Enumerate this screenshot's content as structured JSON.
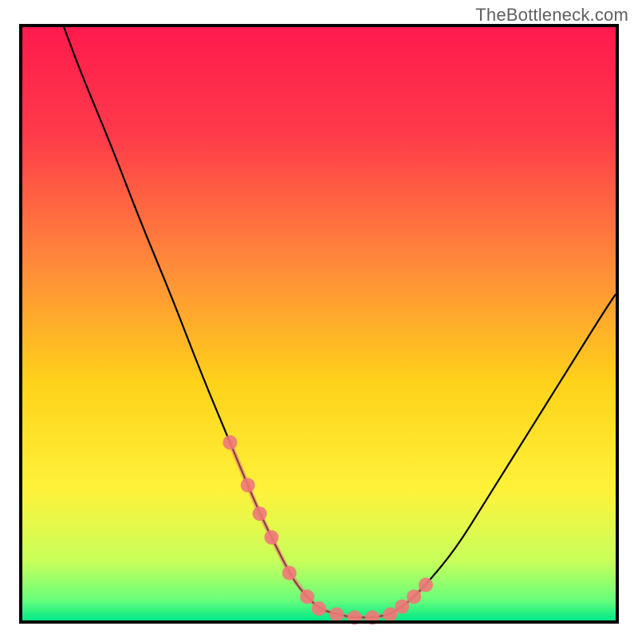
{
  "watermark": "TheBottleneck.com",
  "chart_data": {
    "type": "line",
    "title": "",
    "xlabel": "",
    "ylabel": "",
    "xlim": [
      0,
      100
    ],
    "ylim": [
      0,
      100
    ],
    "grid": false,
    "legend": false,
    "series": [
      {
        "name": "bottleneck-curve",
        "x": [
          7,
          10,
          15,
          20,
          25,
          30,
          35,
          40,
          45,
          47,
          50,
          53,
          56,
          59,
          62,
          65,
          68,
          73,
          78,
          83,
          88,
          93,
          98,
          100
        ],
        "y": [
          100,
          92,
          80,
          67,
          55,
          42,
          30,
          18,
          8,
          5,
          2,
          1,
          0.5,
          0.5,
          1,
          3,
          6,
          12,
          20,
          28,
          36,
          44,
          52,
          55
        ]
      }
    ],
    "highlight_band": {
      "name": "optimal-zone",
      "x_range": [
        35,
        68
      ],
      "points_x": [
        35,
        38,
        40,
        42,
        45,
        48,
        50,
        53,
        56,
        59,
        62,
        64,
        66,
        68
      ],
      "color": "#f07878"
    },
    "background_gradient": {
      "stops": [
        {
          "offset": 0.0,
          "color": "#ff1a4d"
        },
        {
          "offset": 0.18,
          "color": "#ff3a4a"
        },
        {
          "offset": 0.4,
          "color": "#ff8a3a"
        },
        {
          "offset": 0.6,
          "color": "#ffd21a"
        },
        {
          "offset": 0.78,
          "color": "#fff23a"
        },
        {
          "offset": 0.9,
          "color": "#c8ff5a"
        },
        {
          "offset": 0.965,
          "color": "#6aff7a"
        },
        {
          "offset": 1.0,
          "color": "#00e888"
        }
      ]
    },
    "frame_color": "#000000",
    "frame_thickness": 4
  }
}
